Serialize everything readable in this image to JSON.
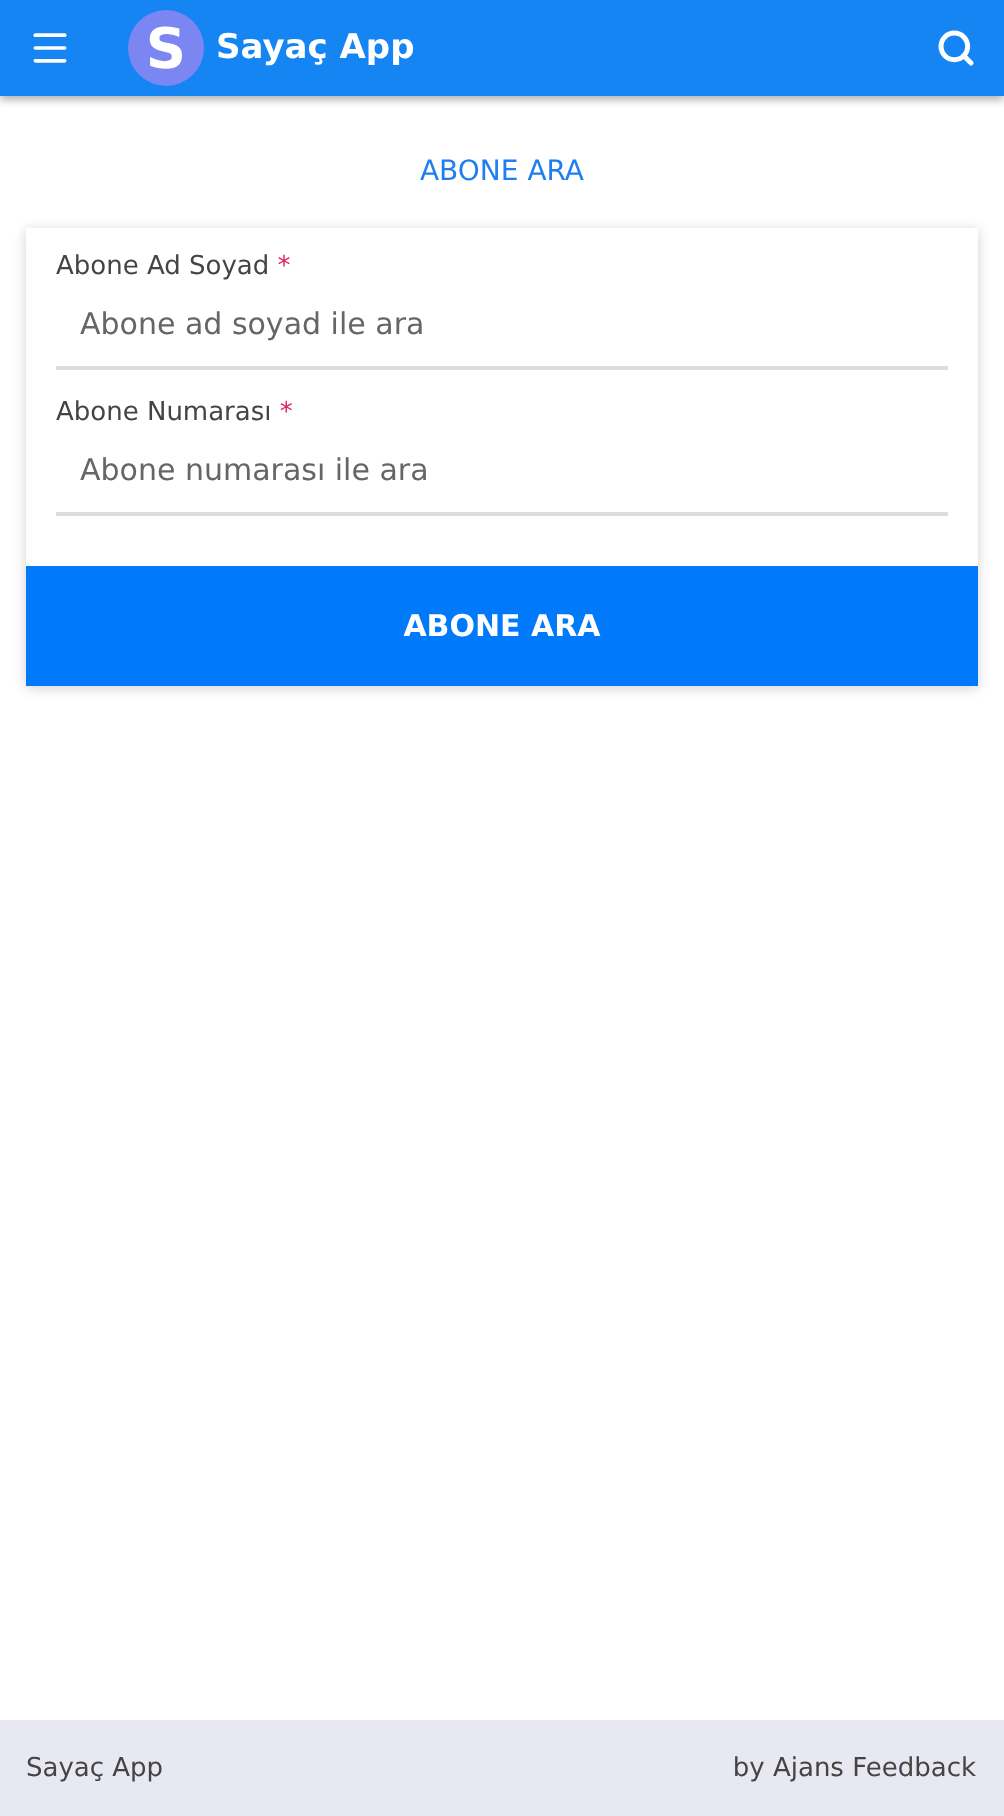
{
  "app_bar": {
    "logo_letter": "S",
    "title": "Sayaç App"
  },
  "page_title": "ABONE ARA",
  "fields": [
    {
      "label": "Abone Ad Soyad",
      "required_mark": "*",
      "placeholder": "Abone ad soyad ile ara"
    },
    {
      "label": "Abone Numarası",
      "required_mark": "*",
      "placeholder": "Abone numarası ile ara"
    }
  ],
  "submit_button": "ABONE ARA",
  "footer": {
    "left": "Sayaç App",
    "right": "by Ajans Feedback"
  }
}
